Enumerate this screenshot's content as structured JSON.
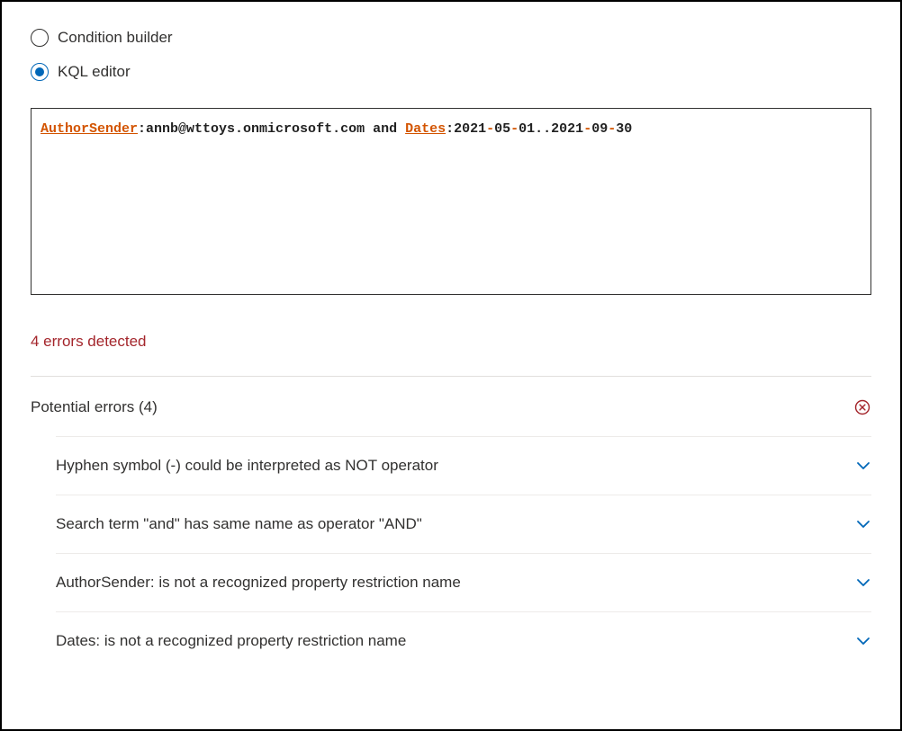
{
  "mode": {
    "options": [
      {
        "label": "Condition builder",
        "selected": false
      },
      {
        "label": "KQL editor",
        "selected": true
      }
    ]
  },
  "query": {
    "tokens": [
      {
        "t": "AuthorSender",
        "cls": "tok-prop"
      },
      {
        "t": ":annb@wttoys.onmicrosoft.com and ",
        "cls": "tok-plain"
      },
      {
        "t": "Dates",
        "cls": "tok-prop"
      },
      {
        "t": ":2021",
        "cls": "tok-plain"
      },
      {
        "t": "-",
        "cls": "tok-hl"
      },
      {
        "t": "05",
        "cls": "tok-plain"
      },
      {
        "t": "-",
        "cls": "tok-hl"
      },
      {
        "t": "01..2021",
        "cls": "tok-plain"
      },
      {
        "t": "-",
        "cls": "tok-hl"
      },
      {
        "t": "09",
        "cls": "tok-plain"
      },
      {
        "t": "-",
        "cls": "tok-hl"
      },
      {
        "t": "30",
        "cls": "tok-plain"
      }
    ]
  },
  "errors": {
    "summary": "4 errors detected",
    "section_label": "Potential errors (4)",
    "items": [
      "Hyphen symbol (-) could be interpreted as NOT operator",
      "Search term \"and\" has same name as operator \"AND\"",
      "AuthorSender: is not a recognized property restriction name",
      "Dates: is not a recognized property restriction name"
    ]
  },
  "colors": {
    "accent": "#0067b8",
    "error": "#a4262c",
    "prop": "#d35400"
  }
}
